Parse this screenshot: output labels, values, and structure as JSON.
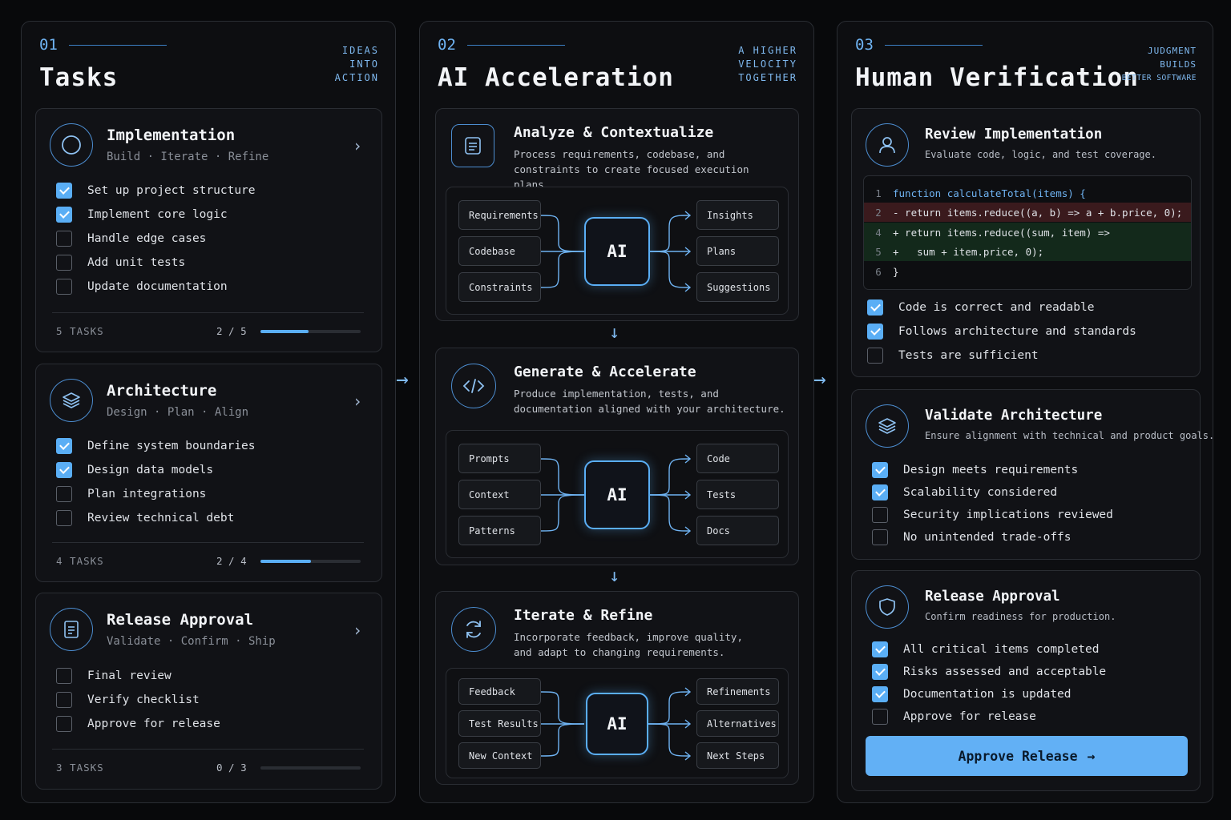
{
  "columns": {
    "tasks": {
      "num": "01",
      "title": "Tasks",
      "tag": [
        "IDEAS",
        "INTO",
        "ACTION"
      ],
      "cards": [
        {
          "title": "Implementation",
          "subtitle": "Build · Iterate · Refine",
          "icon": "circle-icon",
          "items": [
            {
              "label": "Set up project structure",
              "checked": true
            },
            {
              "label": "Implement core logic",
              "checked": true
            },
            {
              "label": "Handle edge cases",
              "checked": false
            },
            {
              "label": "Add unit tests",
              "checked": false
            },
            {
              "label": "Update documentation",
              "checked": false
            }
          ],
          "count": "5 TASKS",
          "ratio": "2 / 5",
          "progress": 0.4
        },
        {
          "title": "Architecture",
          "subtitle": "Design · Plan · Align",
          "icon": "layers-icon",
          "items": [
            {
              "label": "Define system boundaries",
              "checked": true
            },
            {
              "label": "Design data models",
              "checked": true
            },
            {
              "label": "Plan integrations",
              "checked": false
            },
            {
              "label": "Review technical debt",
              "checked": false
            }
          ],
          "count": "4 TASKS",
          "ratio": "2 / 4",
          "progress": 0.5
        },
        {
          "title": "Release Approval",
          "subtitle": "Validate · Confirm · Ship",
          "icon": "document-icon",
          "items": [
            {
              "label": "Final review",
              "checked": false
            },
            {
              "label": "Verify checklist",
              "checked": false
            },
            {
              "label": "Approve for release",
              "checked": false
            }
          ],
          "count": "3 TASKS",
          "ratio": "0 / 3",
          "progress": 0
        }
      ]
    },
    "ai": {
      "num": "02",
      "title": "AI Acceleration",
      "tag": [
        "A HIGHER",
        "VELOCITY",
        "TOGETHER"
      ],
      "stages": [
        {
          "title": "Analyze & Contextualize",
          "icon": "document-icon",
          "desc": [
            "Process requirements, codebase, and",
            "constraints to create focused execution plans."
          ],
          "inputs": [
            "Requirements",
            "Codebase",
            "Constraints"
          ],
          "core": "AI",
          "outputs": [
            "Insights",
            "Plans",
            "Suggestions"
          ]
        },
        {
          "title": "Generate & Accelerate",
          "icon": "code-icon",
          "desc": [
            "Produce implementation, tests, and",
            "documentation aligned with your architecture."
          ],
          "inputs": [
            "Prompts",
            "Context",
            "Patterns"
          ],
          "core": "AI",
          "outputs": [
            "Code",
            "Tests",
            "Docs"
          ]
        },
        {
          "title": "Iterate & Refine",
          "icon": "refresh-icon",
          "desc": [
            "Incorporate feedback, improve quality,",
            "and adapt to changing requirements."
          ],
          "inputs": [
            "Feedback",
            "Test Results",
            "New Context"
          ],
          "core": "AI",
          "outputs": [
            "Refinements",
            "Alternatives",
            "Next Steps"
          ]
        }
      ]
    },
    "human": {
      "num": "03",
      "title": "Human Verification",
      "tag": [
        "JUDGMENT",
        "BUILDS",
        "BETTER SOFTWARE"
      ],
      "review": {
        "title": "Review Implementation",
        "desc": "Evaluate code, logic, and test coverage.",
        "code": [
          {
            "ln": "1",
            "kind": "ctx",
            "text": "function calculateTotal(items) {"
          },
          {
            "ln": "2",
            "kind": "del",
            "text": "- return items.reduce((a, b) => a + b.price, 0);"
          },
          {
            "ln": "4",
            "kind": "add",
            "text": "+ return items.reduce((sum, item) =>"
          },
          {
            "ln": "5",
            "kind": "add",
            "text": "+   sum + item.price, 0);"
          },
          {
            "ln": "6",
            "kind": "ctx",
            "text": "}"
          }
        ],
        "items": [
          {
            "label": "Code is correct and readable",
            "checked": true
          },
          {
            "label": "Follows architecture and standards",
            "checked": true
          },
          {
            "label": "Tests are sufficient",
            "checked": false
          }
        ]
      },
      "validate": {
        "title": "Validate Architecture",
        "desc": "Ensure alignment with technical and product goals.",
        "items": [
          {
            "label": "Design meets requirements",
            "checked": true
          },
          {
            "label": "Scalability considered",
            "checked": true
          },
          {
            "label": "Security implications reviewed",
            "checked": false
          },
          {
            "label": "No unintended trade-offs",
            "checked": false
          }
        ]
      },
      "release": {
        "title": "Release Approval",
        "desc": "Confirm readiness for production.",
        "items": [
          {
            "label": "All critical items completed",
            "checked": true
          },
          {
            "label": "Risks assessed and acceptable",
            "checked": true
          },
          {
            "label": "Documentation is updated",
            "checked": true
          },
          {
            "label": "Approve for release",
            "checked": false
          }
        ],
        "button": "Approve Release"
      }
    }
  },
  "colors": {
    "accent": "#5aaef5",
    "background": "#08090b",
    "panel": "#0d0e11",
    "border": "#2a2d33"
  }
}
